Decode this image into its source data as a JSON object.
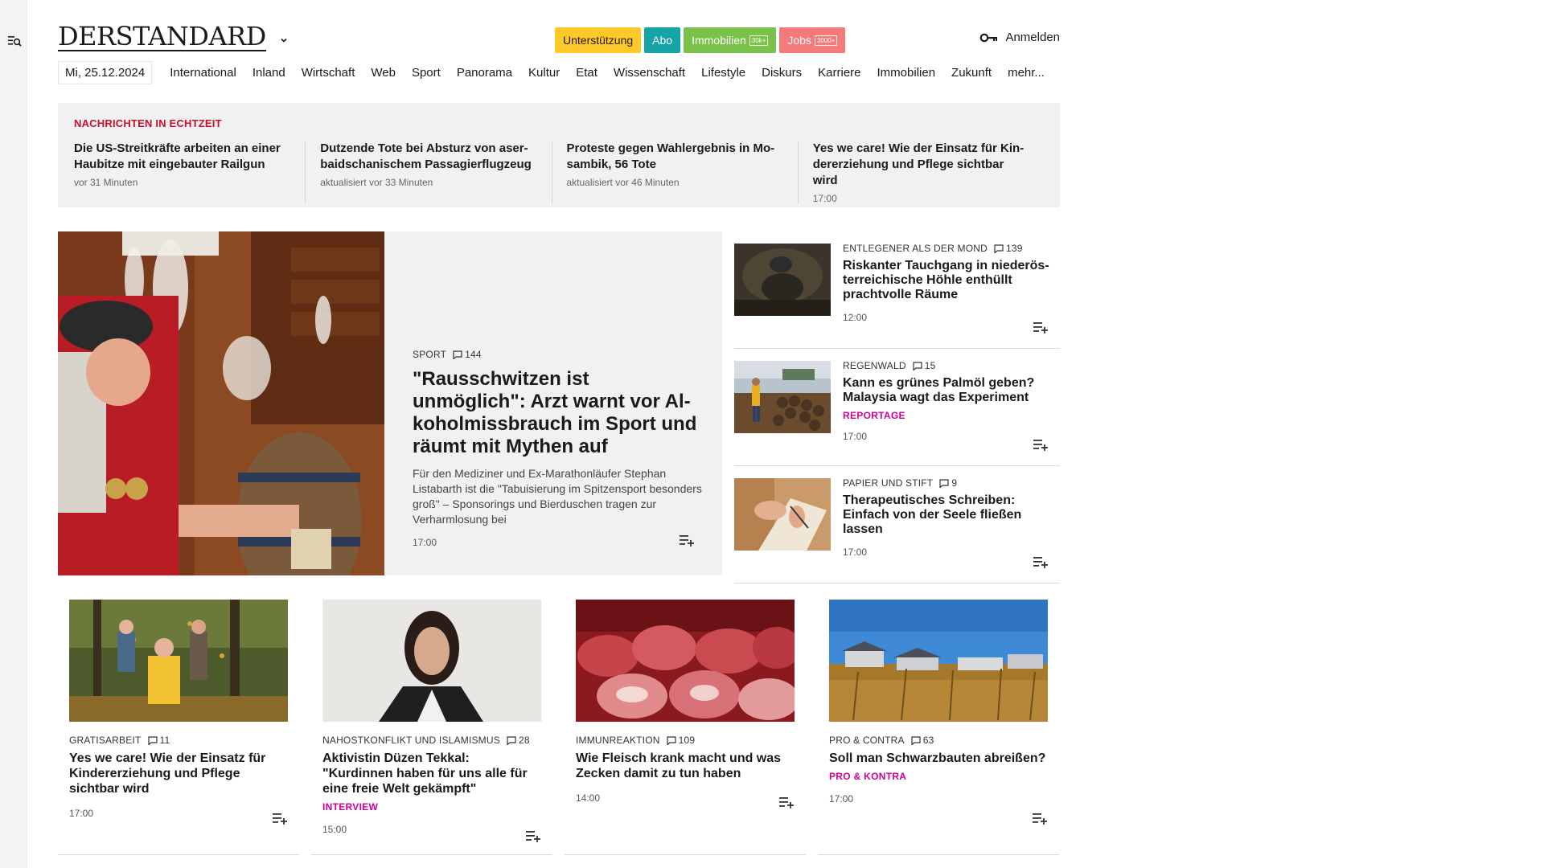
{
  "header": {
    "logo_text": "DERSTANDARD",
    "pills": [
      {
        "label": "Unterstützung",
        "tag": "",
        "bg": "#ffc829",
        "fg": "#1a1a1a"
      },
      {
        "label": "Abo",
        "tag": "",
        "bg": "#16a4a8",
        "fg": "#ffffff"
      },
      {
        "label": "Immobilien",
        "tag": "30k+",
        "bg": "#7ac24a",
        "fg": "#ffffff"
      },
      {
        "label": "Jobs",
        "tag": "3000+",
        "bg": "#f57a7a",
        "fg": "#ffffff"
      }
    ],
    "login_label": "Anmelden"
  },
  "nav": {
    "date": "Mi, 25.12.2024",
    "items": [
      "International",
      "Inland",
      "Wirtschaft",
      "Web",
      "Sport",
      "Panorama",
      "Kultur",
      "Etat",
      "Wissenschaft",
      "Lifestyle",
      "Diskurs",
      "Karriere",
      "Immobilien",
      "Zukunft",
      "mehr..."
    ]
  },
  "ticker": {
    "label": "NACHRICHTEN IN ECHTZEIT",
    "items": [
      {
        "title": "Die US-Streitkräfte arbeiten an einer Haubitze mit eingebauter Railgun",
        "time": "vor 31 Minuten"
      },
      {
        "title": "Dutzende Tote bei Absturz von aser-baidschanischem Passagierflugzeug",
        "time": "aktualisiert vor 33 Minuten"
      },
      {
        "title": "Proteste gegen Wahlergebnis in Mo-sambik, 56 Tote",
        "time": "aktualisiert vor 46 Minuten"
      },
      {
        "title": "Yes we care! Wie der Einsatz für Kin-dererziehung und Pflege sichtbar wird",
        "time": "17:00"
      }
    ]
  },
  "hero": {
    "kicker": "SPORT",
    "comments": "144",
    "title": "\"Rausschwitzen ist unmöglich\": Arzt warnt vor Al-koholmissbrauch im Sport und räumt mit Mythen auf",
    "teaser": "Für den Mediziner und Ex-Marathonläufer Stephan Listabarth ist die \"Tabuisierung im Spitzensport besonders groß\" – Sponsorings und Bierduschen tragen zur Verharmlosung bei",
    "time": "17:00"
  },
  "side": [
    {
      "kicker": "ENTLEGENER ALS DER MOND",
      "comments": "139",
      "title": "Riskanter Tauchgang in niederös-terreichische Höhle enthüllt prachtvolle Räume",
      "flag": "",
      "time": "12:00"
    },
    {
      "kicker": "REGENWALD",
      "comments": "15",
      "title": "Kann es grünes Palmöl geben? Malaysia wagt das Experiment",
      "flag": "REPORTAGE",
      "time": "17:00"
    },
    {
      "kicker": "PAPIER UND STIFT",
      "comments": "9",
      "title": "Therapeutisches Schreiben: Einfach von der Seele fließen lassen",
      "flag": "",
      "time": "17:00"
    }
  ],
  "cards": [
    {
      "kicker": "GRATISARBEIT",
      "comments": "11",
      "title": "Yes we care! Wie der Einsatz für Kindererziehung und Pflege sichtbar wird",
      "flag": "",
      "time": "17:00"
    },
    {
      "kicker": "NAHOSTKONFLIKT UND ISLAMISMUS",
      "comments": "28",
      "title": "Aktivistin Düzen Tekkal: \"Kurdinnen haben für uns alle für eine freie Welt gekämpft\"",
      "flag": "INTERVIEW",
      "time": "15:00"
    },
    {
      "kicker": "IMMUNREAKTION",
      "comments": "109",
      "title": "Wie Fleisch krank macht und was Zecken damit zu tun haben",
      "flag": "",
      "time": "14:00"
    },
    {
      "kicker": "PRO & CONTRA",
      "comments": "63",
      "title": "Soll man Schwarzbauten abreißen?",
      "flag": "PRO & KONTRA",
      "time": "17:00"
    }
  ],
  "icons": {
    "menu": "menu-search-icon",
    "caret": "chevron-down-icon",
    "login": "key-icon",
    "comment": "comment-icon",
    "add": "add-to-list-icon"
  },
  "colors": {
    "live_red": "#c8102e",
    "flag_magenta": "#cc0099",
    "panel_grey": "#f1f1f1"
  }
}
